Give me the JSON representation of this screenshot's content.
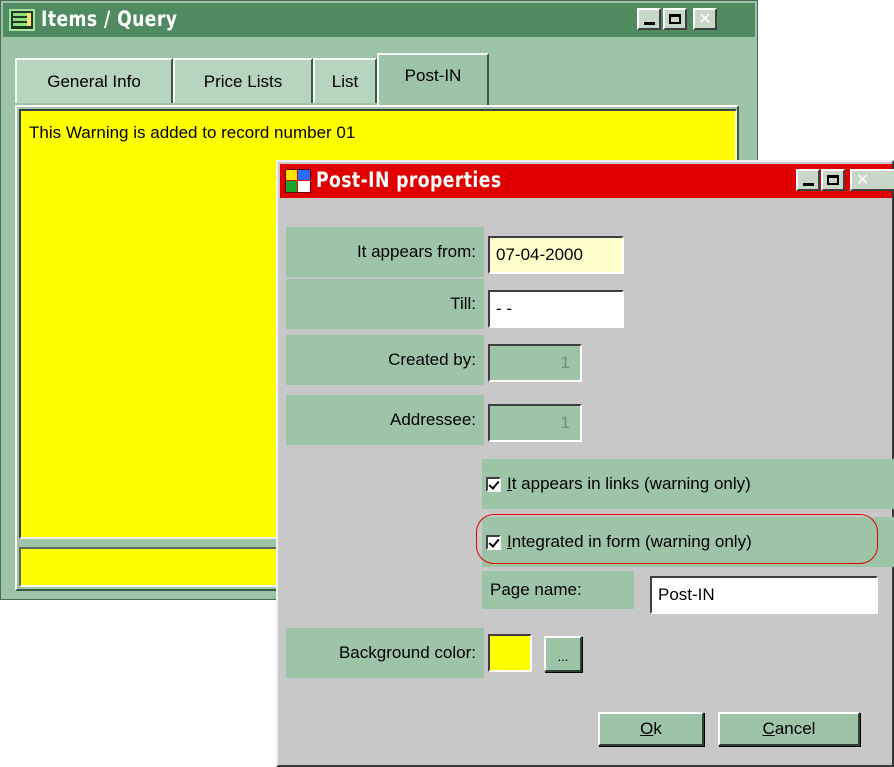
{
  "items_window": {
    "title": "Items / Query",
    "tabs": [
      "General Info",
      "Price Lists",
      "List",
      "Post-IN"
    ],
    "active_tab": "Post-IN",
    "warning_text": "This Warning is added to record number 01",
    "warning_background": "#ffff00"
  },
  "postin_dialog": {
    "title": "Post-IN properties",
    "appears_from": {
      "label": "It appears from:",
      "value": "07-04-2000"
    },
    "till": {
      "label": "Till:",
      "value": "- -"
    },
    "created_by": {
      "label": "Created by:",
      "value": "1"
    },
    "addressee": {
      "label": "Addressee:",
      "value": "1"
    },
    "appears_in_links": {
      "accel": "I",
      "rest": "t appears in links (warning only)",
      "checked": true
    },
    "integrated_in_form": {
      "accel": "I",
      "rest": "ntegrated in form (warning only)",
      "checked": true
    },
    "page_name": {
      "label": "Page name:",
      "value": "Post-IN"
    },
    "background_color": {
      "label": "Background color:",
      "value": "#ffff00",
      "picker_label": "..."
    },
    "ok_button": {
      "accel": "O",
      "rest": "k"
    },
    "cancel_button": {
      "accel": "C",
      "rest": "ancel"
    }
  },
  "colors": {
    "items_title_bar": "#4f8a60",
    "postin_title_bar": "#e00000",
    "panel_green": "#9ec4a8",
    "dialog_gray": "#c8c8c8",
    "highlight": "#e00000"
  }
}
